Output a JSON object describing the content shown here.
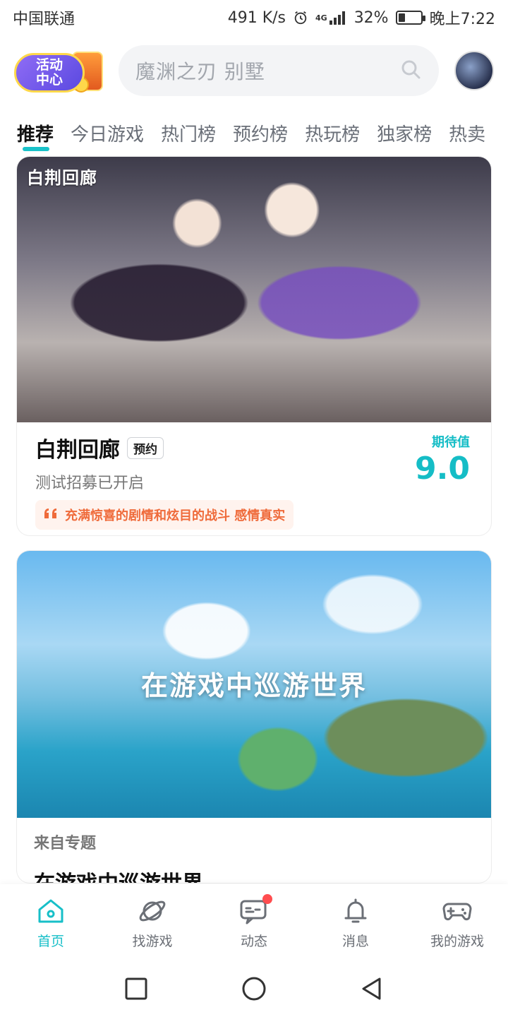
{
  "status_bar": {
    "carrier": "中国联通",
    "speed": "491 K/s",
    "network": "4G",
    "battery": "32%",
    "battery_level": 0.32,
    "time": "晚上7:22"
  },
  "header": {
    "activity_line1": "活动",
    "activity_line2": "中心",
    "search_placeholder": "魔渊之刃 别墅"
  },
  "tabs": [
    "推荐",
    "今日游戏",
    "热门榜",
    "预约榜",
    "热玩榜",
    "独家榜",
    "热卖"
  ],
  "card1": {
    "logo_text": "白荆回廊",
    "title": "白荆回廊",
    "badge": "预约",
    "subtitle": "测试招募已开启",
    "quote": "充满惊喜的剧情和炫目的战斗 感情真实",
    "score_label": "期待值",
    "score_value": "9.0"
  },
  "card2": {
    "hero_title": "在游戏中巡游世界",
    "from_label": "来自专题",
    "topic_title": "在游戏中巡游世界"
  },
  "bottom_nav": [
    {
      "label": "首页",
      "icon": "home-icon",
      "active": true
    },
    {
      "label": "找游戏",
      "icon": "planet-icon"
    },
    {
      "label": "动态",
      "icon": "chat-icon",
      "dot": true
    },
    {
      "label": "消息",
      "icon": "bell-icon"
    },
    {
      "label": "我的游戏",
      "icon": "gamepad-icon"
    }
  ],
  "colors": {
    "accent": "#17bfc8",
    "quote_text": "#ef6b3b",
    "quote_bg": "#fff3ee"
  }
}
